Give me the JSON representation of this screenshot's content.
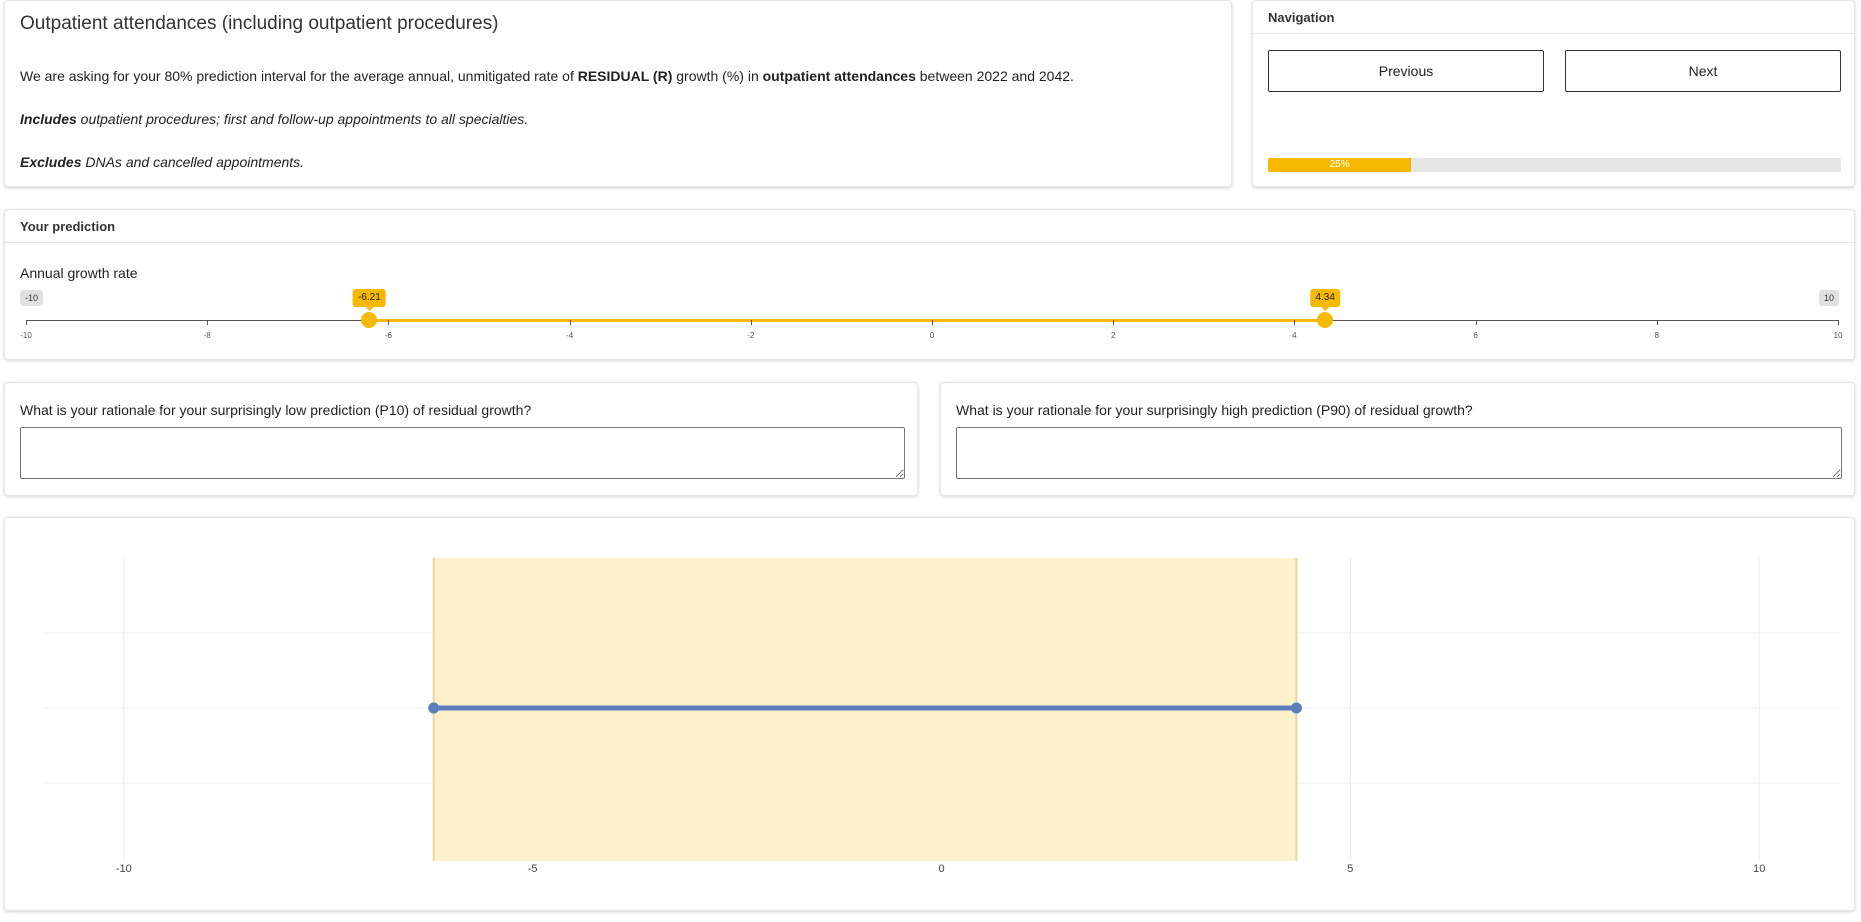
{
  "question": {
    "title": "Outpatient attendances (including outpatient procedures)",
    "line1_pre": "We are asking for your 80% prediction interval for the average annual, unmitigated rate of ",
    "line1_bold1": "RESIDUAL (R)",
    "line1_mid": " growth (%) in ",
    "line1_bold2": "outpatient attendances",
    "line1_post": " between 2022 and 2042.",
    "includes_label": "Includes",
    "includes_text": " outpatient procedures; first and follow-up appointments to all specialties.",
    "excludes_label": "Excludes",
    "excludes_text": " DNAs and cancelled appointments."
  },
  "navigation": {
    "header": "Navigation",
    "previous_label": "Previous",
    "next_label": "Next",
    "progress_fraction": 0.25,
    "progress_text": "25%",
    "accent_color": "#f7b900"
  },
  "prediction": {
    "header": "Your prediction",
    "slider_label": "Annual growth rate",
    "min": -10,
    "max": 10,
    "min_label": "-10",
    "max_label": "10",
    "low_value": -6.21,
    "high_value": 4.34,
    "low_label": "-6.21",
    "high_label": "4.34",
    "tick_labels": [
      "-10",
      "-8",
      "-6",
      "-4",
      "-2",
      "0",
      "2",
      "4",
      "6",
      "8",
      "10"
    ]
  },
  "rationale": {
    "low_question": "What is your rationale for your surprisingly low prediction (P10) of residual growth?",
    "low_value": "",
    "high_question": "What is your rationale for your surprisingly high prediction (P90) of residual growth?",
    "high_value": ""
  },
  "chart_data": {
    "type": "interval",
    "title": "",
    "xlabel": "",
    "ylabel": "",
    "xlim": [
      -11,
      11
    ],
    "x_ticks": [
      -10,
      -5,
      0,
      5,
      10
    ],
    "x_tick_labels": [
      "-10",
      "-5",
      "0",
      "5",
      "10"
    ],
    "interval": {
      "low": -6.21,
      "high": 4.34
    },
    "band_color": "#fdf0cc",
    "line_color": "#5b7fbd",
    "grid": true
  }
}
